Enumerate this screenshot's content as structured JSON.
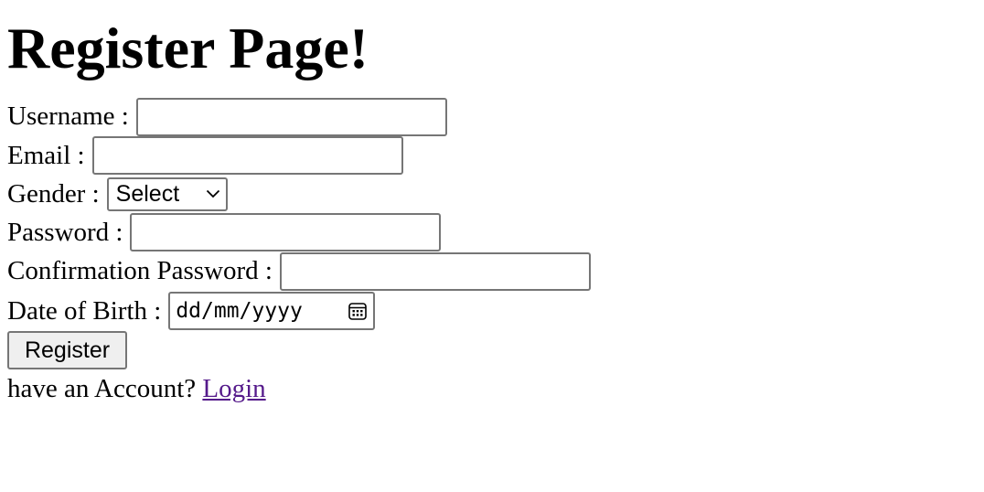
{
  "heading": "Register Page!",
  "form": {
    "username_label": "Username :",
    "username_value": "",
    "email_label": "Email :",
    "email_value": "",
    "gender_label": "Gender :",
    "gender_selected": "Select",
    "password_label": "Password :",
    "password_value": "",
    "confirm_label": "Confirmation Password :",
    "confirm_value": "",
    "dob_label": "Date of Birth :",
    "dob_placeholder": "dd/mm/yyyy",
    "submit_label": "Register"
  },
  "footer": {
    "prompt": "have an Account?",
    "login_link": "Login"
  },
  "icons": {
    "gender_dropdown": "chevron-down-icon",
    "dob_picker": "calendar-icon"
  },
  "colors": {
    "link": "#551a8b",
    "border": "#767676",
    "button_bg": "#efefef"
  }
}
